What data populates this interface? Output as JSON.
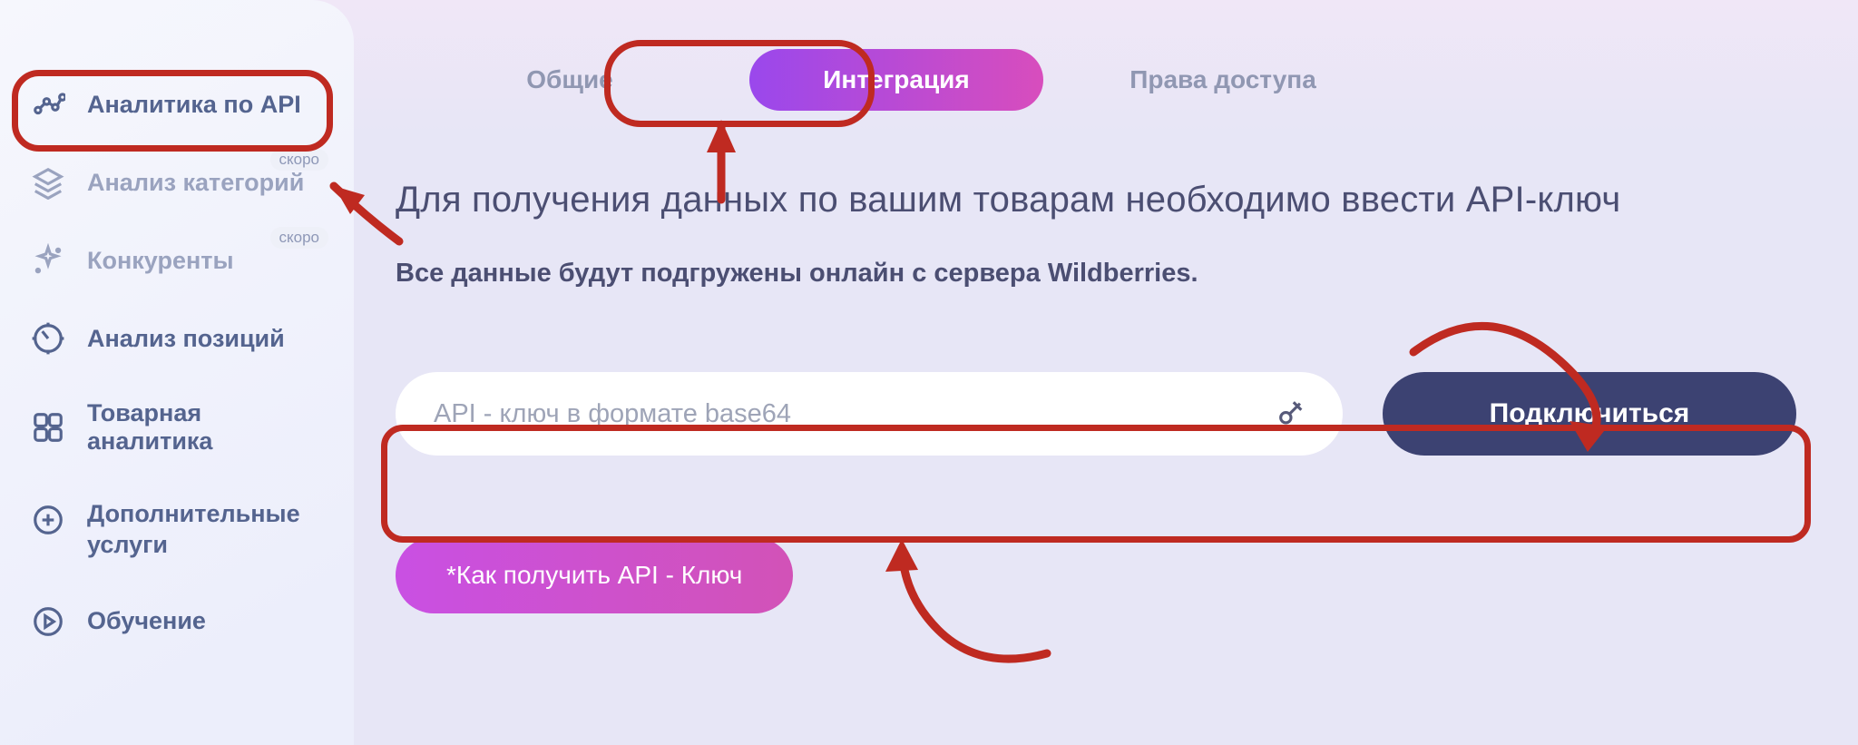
{
  "sidebar": {
    "badge_text": "скоро",
    "items": [
      {
        "label": "Аналитика по API",
        "muted": false,
        "badge": false
      },
      {
        "label": "Анализ категорий",
        "muted": true,
        "badge": true
      },
      {
        "label": "Конкуренты",
        "muted": true,
        "badge": true
      },
      {
        "label": "Анализ позиций",
        "muted": false,
        "badge": false
      },
      {
        "label": "Товарная аналитика",
        "muted": false,
        "badge": false
      },
      {
        "label": "Дополнительные услуги",
        "muted": false,
        "badge": false
      },
      {
        "label": "Обучение",
        "muted": false,
        "badge": false
      }
    ]
  },
  "tabs": [
    {
      "label": "Общие",
      "active": false
    },
    {
      "label": "Интеграция",
      "active": true
    },
    {
      "label": "Права доступа",
      "active": false
    }
  ],
  "page": {
    "title": "Для получения данных по вашим товарам необходимо ввести API-ключ",
    "subtitle": "Все данные будут подгружены онлайн с сервера Wildberries."
  },
  "form": {
    "api_placeholder": "API - ключ в формате base64",
    "api_value": "",
    "connect_label": "Подключиться",
    "help_label": "*Как получить API - Ключ"
  }
}
